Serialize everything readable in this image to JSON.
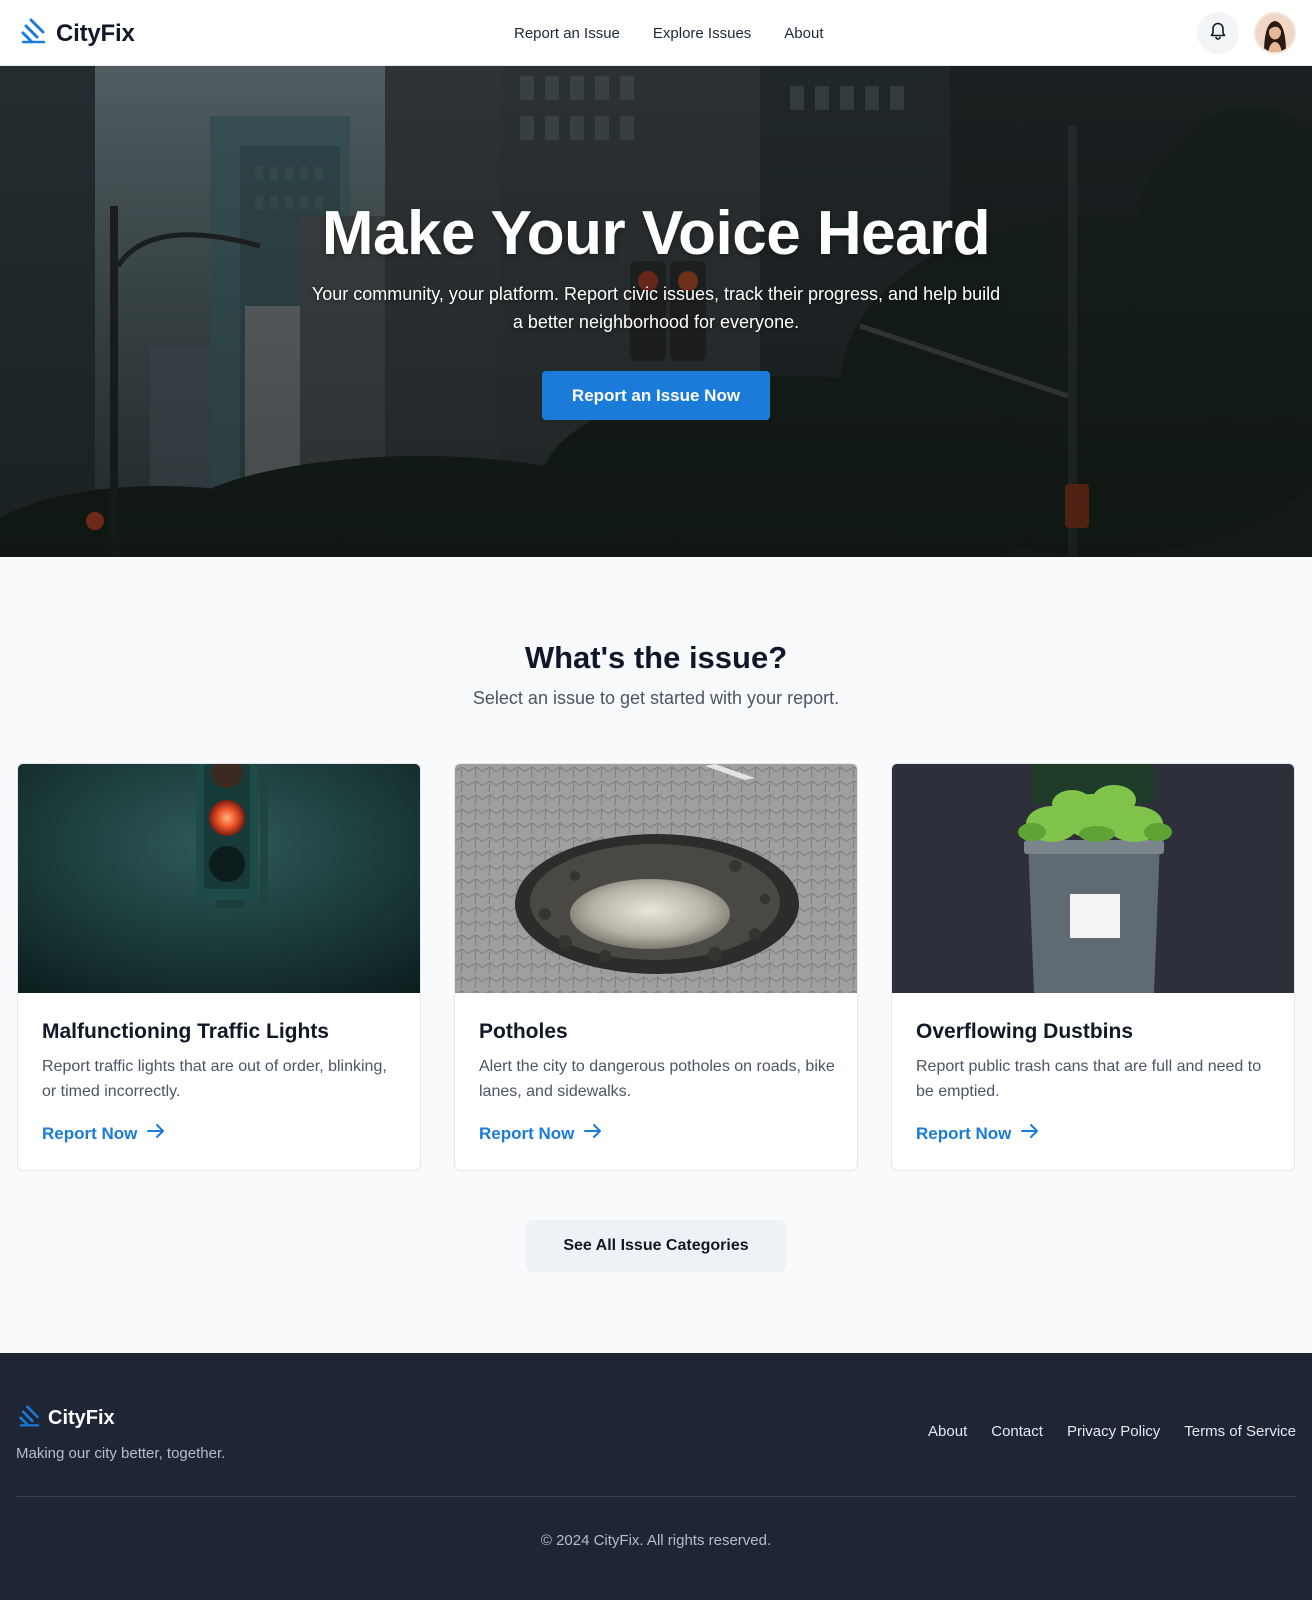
{
  "colors": {
    "accent": "#1a7bd8",
    "footer_bg": "#1e2636",
    "page_bg": "#f8fafc"
  },
  "header": {
    "brand": "CityFix",
    "brand_icon": "lightning-logo-icon",
    "nav": [
      "Report an Issue",
      "Explore Issues",
      "About"
    ],
    "notification_icon": "bell-icon"
  },
  "hero": {
    "title": "Make Your Voice Heard",
    "subtitle": "Your community, your platform. Report civic issues, track their progress, and help build a better neighborhood for everyone.",
    "cta": "Report an Issue Now"
  },
  "issues": {
    "title": "What's the issue?",
    "subtitle": "Select an issue to get started with your report.",
    "cards": [
      {
        "title": "Malfunctioning Traffic Lights",
        "description": "Report traffic lights that are out of order, blinking, or timed incorrectly.",
        "link": "Report Now"
      },
      {
        "title": "Potholes",
        "description": "Alert the city to dangerous potholes on roads, bike lanes, and sidewalks.",
        "link": "Report Now"
      },
      {
        "title": "Overflowing Dustbins",
        "description": "Report public trash cans that are full and need to be emptied.",
        "link": "Report Now"
      }
    ],
    "see_all": "See All Issue Categories"
  },
  "footer": {
    "brand": "CityFix",
    "tagline": "Making our city better, together.",
    "links": [
      "About",
      "Contact",
      "Privacy Policy",
      "Terms of Service"
    ],
    "copyright": "© 2024 CityFix. All rights reserved."
  }
}
